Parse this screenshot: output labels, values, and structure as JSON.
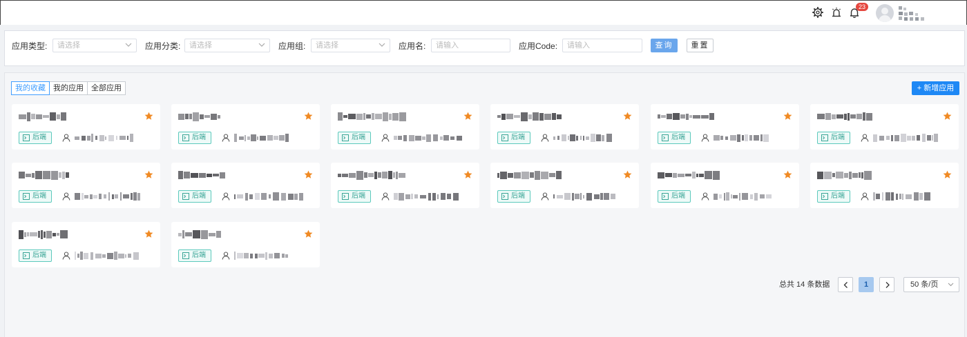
{
  "header": {
    "notification_count": "23",
    "username_redacted": true
  },
  "filters": {
    "app_type_label": "应用类型:",
    "app_type_placeholder": "请选择",
    "app_category_label": "应用分类:",
    "app_category_placeholder": "请选择",
    "app_group_label": "应用组:",
    "app_group_placeholder": "请选择",
    "app_name_label": "应用名:",
    "app_name_placeholder": "请输入",
    "app_code_label": "应用Code:",
    "app_code_placeholder": "请输入",
    "query_label": "查询",
    "reset_label": "重置"
  },
  "tabs": [
    {
      "label": "我的收藏",
      "active": true
    },
    {
      "label": "我的应用",
      "active": false
    },
    {
      "label": "全部应用",
      "active": false
    }
  ],
  "add_app_label": "+ 新增应用",
  "cards": [
    {
      "tag": "后端",
      "favorited": true,
      "name_redacted": true,
      "owner_redacted": true
    },
    {
      "tag": "后端",
      "favorited": true,
      "name_redacted": true,
      "owner_redacted": true
    },
    {
      "tag": "后端",
      "favorited": true,
      "name_redacted": true,
      "owner_redacted": true
    },
    {
      "tag": "后端",
      "favorited": true,
      "name_redacted": true,
      "owner_redacted": true
    },
    {
      "tag": "后端",
      "favorited": true,
      "name_redacted": true,
      "owner_redacted": true
    },
    {
      "tag": "后端",
      "favorited": true,
      "name_redacted": true,
      "owner_redacted": true
    },
    {
      "tag": "后端",
      "favorited": true,
      "name_redacted": true,
      "owner_redacted": true
    },
    {
      "tag": "后端",
      "favorited": true,
      "name_redacted": true,
      "owner_redacted": true
    },
    {
      "tag": "后端",
      "favorited": true,
      "name_redacted": true,
      "owner_redacted": true
    },
    {
      "tag": "后端",
      "favorited": true,
      "name_redacted": true,
      "owner_redacted": true
    },
    {
      "tag": "后端",
      "favorited": true,
      "name_redacted": true,
      "owner_redacted": true
    },
    {
      "tag": "后端",
      "favorited": true,
      "name_redacted": true,
      "owner_redacted": true
    },
    {
      "tag": "后端",
      "favorited": true,
      "name_redacted": true,
      "owner_redacted": true
    },
    {
      "tag": "后端",
      "favorited": true,
      "name_redacted": true,
      "owner_redacted": true
    }
  ],
  "pagination": {
    "total_text": "总共 14 条数据",
    "current_page": "1",
    "page_size": "50 条/页"
  },
  "colors": {
    "primary": "#1e88f5",
    "star": "#f08a24",
    "tag": "#3aa596",
    "badge": "#e5473f"
  },
  "icons": [
    "gear-icon",
    "alarm-icon",
    "bell-icon",
    "star-icon",
    "terminal-icon",
    "user-icon",
    "chevron-down-icon",
    "chevron-left-icon",
    "chevron-right-icon"
  ]
}
